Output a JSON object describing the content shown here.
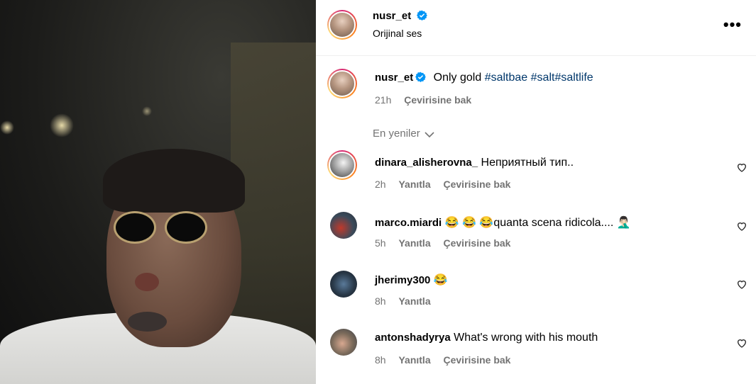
{
  "post": {
    "author": "nusr_et",
    "audio_label": "Orijinal ses",
    "caption_text": "Only gold",
    "hashtags": [
      "#saltbae",
      "#salt",
      "#saltlife"
    ],
    "time": "21h",
    "translate_label": "Çevirisine bak"
  },
  "sort_label": "En yeniler",
  "reply_label": "Yanıtla",
  "comments": [
    {
      "user": "dinara_alisherovna_",
      "text": "Неприятный тип..",
      "time": "2h",
      "translate": "Çevirisine bak"
    },
    {
      "user": "marco.miardi",
      "text": "😂 😂 😂quanta scena ridicola.... 🤦🏻‍♂️",
      "time": "5h",
      "translate": "Çevirisine bak"
    },
    {
      "user": "jherimy300",
      "text": "😂",
      "time": "8h",
      "translate": ""
    },
    {
      "user": "antonshadyrya",
      "text": "What's wrong with his mouth",
      "time": "8h",
      "translate": "Çevirisine bak"
    }
  ],
  "colors": {
    "verified": "#0095f6",
    "hashtag": "#00376b",
    "muted": "#737373"
  },
  "icons": [
    "verified-badge-icon",
    "more-options-icon",
    "chevron-down-icon",
    "heart-icon"
  ]
}
